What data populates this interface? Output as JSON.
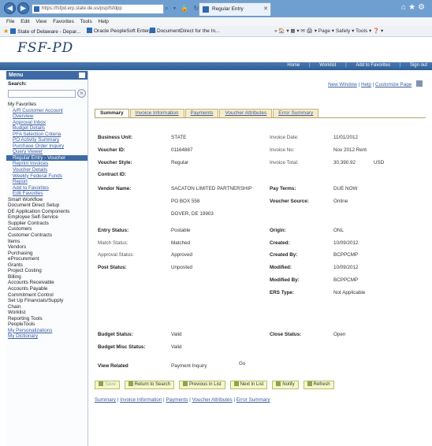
{
  "browser": {
    "url": "https://fsfpd.erp.state.de.us/psp/fsfdpp",
    "url_tools": "⌕ ▾ 🔒 ↻ ✕",
    "tab_title": "Regular Entry",
    "menu": [
      "File",
      "Edit",
      "View",
      "Favorites",
      "Tools",
      "Help"
    ],
    "favorites": [
      "State of Delaware - Depar...",
      "Oracle PeopleSoft Enterp...",
      "DocumentDirect for the In..."
    ],
    "commands": "»  🏠 ▾  ▦ ▾  ✉  🖨 ▾  Page ▾  Safety ▾  Tools ▾  ❓ ▾"
  },
  "app": {
    "logo": "FSF-PD",
    "header_links": [
      "Home",
      "Worklist",
      "Add to Favorites",
      "Sign out"
    ]
  },
  "menu": {
    "title": "Menu",
    "search_label": "Search:",
    "items": [
      {
        "label": "My Favorites",
        "kind": "fav-head"
      },
      {
        "label": "A/R Customer Account",
        "kind": "sub"
      },
      {
        "label": "Overview",
        "kind": "sub"
      },
      {
        "label": "Approval Inbox",
        "kind": "sub"
      },
      {
        "label": "Budget Details",
        "kind": "sub"
      },
      {
        "label": "PFA Selection Criteria",
        "kind": "sub"
      },
      {
        "label": "PO Activity Summary",
        "kind": "sub"
      },
      {
        "label": "Purchase Order Inquiry",
        "kind": "sub"
      },
      {
        "label": "Query Viewer",
        "kind": "sub"
      },
      {
        "label": "Regular Entry - Voucher",
        "kind": "sub active"
      },
      {
        "label": "Reprint Invoices",
        "kind": "sub"
      },
      {
        "label": "Voucher Details",
        "kind": "sub"
      },
      {
        "label": "Weekly Federal Funds",
        "kind": "sub"
      },
      {
        "label": "Report",
        "kind": "sub"
      },
      {
        "label": "Add to Favorites",
        "kind": "sub"
      },
      {
        "label": "Edit Favorites",
        "kind": "sub"
      },
      {
        "label": "Smart Workflow",
        "kind": "top"
      },
      {
        "label": "Document Direct Setup",
        "kind": "top"
      },
      {
        "label": "DE Application Components",
        "kind": "top"
      },
      {
        "label": "Employee Self-Service",
        "kind": "top"
      },
      {
        "label": "Supplier Contracts",
        "kind": "top"
      },
      {
        "label": "Customers",
        "kind": "top"
      },
      {
        "label": "Customer Contracts",
        "kind": "top"
      },
      {
        "label": "Items",
        "kind": "top"
      },
      {
        "label": "Vendors",
        "kind": "top"
      },
      {
        "label": "Purchasing",
        "kind": "top"
      },
      {
        "label": "eProcurement",
        "kind": "top"
      },
      {
        "label": "Grants",
        "kind": "top"
      },
      {
        "label": "Project Costing",
        "kind": "top"
      },
      {
        "label": "Billing",
        "kind": "top"
      },
      {
        "label": "Accounts Receivable",
        "kind": "top"
      },
      {
        "label": "Accounts Payable",
        "kind": "top"
      },
      {
        "label": "Commitment Control",
        "kind": "top"
      },
      {
        "label": "Set Up Financials/Supply",
        "kind": "top"
      },
      {
        "label": "Chain",
        "kind": "top"
      },
      {
        "label": "Worklist",
        "kind": "top"
      },
      {
        "label": "Reporting Tools",
        "kind": "top"
      },
      {
        "label": "PeopleTools",
        "kind": "top"
      },
      {
        "label": "My Personalizations",
        "kind": "toplink"
      },
      {
        "label": "My Dictionary",
        "kind": "toplink"
      }
    ]
  },
  "top_links": {
    "new_window": "New Window",
    "help": "Help",
    "customize": "Customize Page",
    "sep": "|"
  },
  "tabs": [
    {
      "label": "Summary",
      "active": true
    },
    {
      "label": "Invoice Information",
      "active": false
    },
    {
      "label": "Payments",
      "active": false
    },
    {
      "label": "Voucher Attributes",
      "active": false
    },
    {
      "label": "Error Summary",
      "active": false
    }
  ],
  "summary": {
    "business_unit": {
      "label": "Business Unit:",
      "value": "STATE"
    },
    "voucher_id": {
      "label": "Voucher ID:",
      "value": "01164887"
    },
    "voucher_style": {
      "label": "Voucher Style:",
      "value": "Regular"
    },
    "contract_id": {
      "label": "Contract ID:",
      "value": ""
    },
    "vendor_name": {
      "label": "Vendor Name:",
      "value": "SACATON LIMITED PARTNERSHIP"
    },
    "vendor_addr1": "PO BOX 558",
    "vendor_addr2": "DOVER, DE  19903",
    "invoice_date": {
      "label": "Invoice Date:",
      "value": "11/01/2012"
    },
    "invoice_no": {
      "label": "Invoice No:",
      "value": "Nov 2012 Rent"
    },
    "invoice_total": {
      "label": "Invoice Total:",
      "value": "30,390.92",
      "currency": "USD"
    },
    "pay_terms": {
      "label": "Pay Terms:",
      "value": "DUE NOW"
    },
    "voucher_source": {
      "label": "Voucher Source:",
      "value": "Online"
    },
    "entry_status": {
      "label": "Entry Status:",
      "value": "Postable"
    },
    "match_status": {
      "label": "Match Status:",
      "value": "Matched"
    },
    "approval_status": {
      "label": "Approval Status:",
      "value": "Approved"
    },
    "post_status": {
      "label": "Post Status:",
      "value": "Unposted"
    },
    "origin": {
      "label": "Origin:",
      "value": "ONL"
    },
    "created": {
      "label": "Created:",
      "value": "10/09/2012"
    },
    "created_by": {
      "label": "Created By:",
      "value": "BCPPCMP"
    },
    "modified": {
      "label": "Modified:",
      "value": "10/09/2012"
    },
    "modified_by": {
      "label": "Modified By:",
      "value": "BCPPCMP"
    },
    "ers_type": {
      "label": "ERS Type:",
      "value": "Not Applicable"
    },
    "budget_status": {
      "label": "Budget Status:",
      "value": "Valid"
    },
    "budget_misc_status": {
      "label": "Budget Misc Status:",
      "value": "Valid"
    },
    "close_status": {
      "label": "Close Status:",
      "value": "Open"
    },
    "view_related": {
      "label": "View Related",
      "value": "Payment Inquiry",
      "go": "Go"
    }
  },
  "buttons": {
    "save": "Save",
    "return_to_search": "Return to Search",
    "previous_in_list": "Previous in List",
    "next_in_list": "Next in List",
    "notify": "Notify",
    "refresh": "Refresh"
  },
  "bottom_links": [
    "Summary",
    "Invoice Information",
    "Payments",
    "Voucher Attributes",
    "Error Summary"
  ]
}
